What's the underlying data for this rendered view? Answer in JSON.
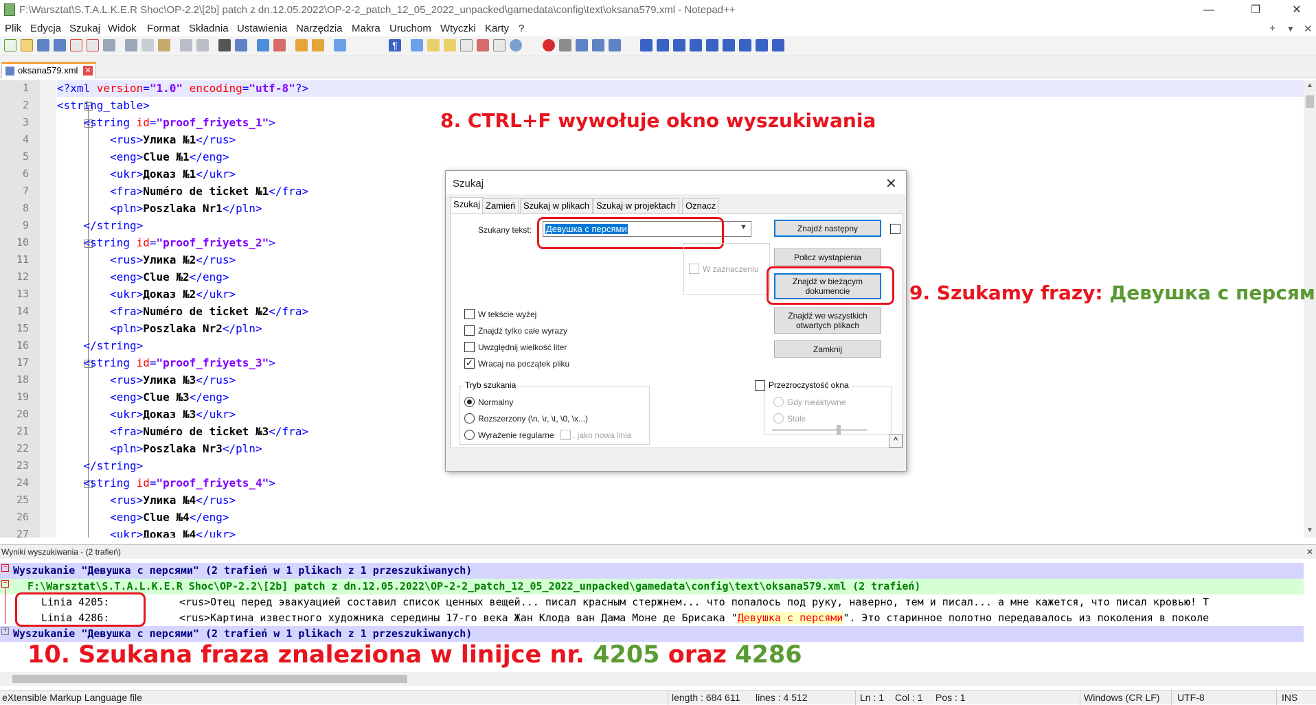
{
  "window": {
    "title": "F:\\Warsztat\\S.T.A.L.K.E.R Shoc\\OP-2.2\\[2b] patch z dn.12.05.2022\\OP-2-2_patch_12_05_2022_unpacked\\gamedata\\config\\text\\oksana579.xml - Notepad++",
    "controls": {
      "minimize": "—",
      "maximize": "❐",
      "close": "✕"
    },
    "menu_extra": {
      "add": "+",
      "list": "▼",
      "close": "✕"
    }
  },
  "menu": [
    "Plik",
    "Edycja",
    "Szukaj",
    "Widok",
    "Format",
    "Składnia",
    "Ustawienia",
    "Narzędzia",
    "Makra",
    "Uruchom",
    "Wtyczki",
    "Karty",
    "?"
  ],
  "tab": {
    "label": "oksana579.xml",
    "close": "✕"
  },
  "editor": {
    "line_numbers": [
      "1",
      "2",
      "3",
      "4",
      "5",
      "6",
      "7",
      "8",
      "9",
      "10",
      "11",
      "12",
      "13",
      "14",
      "15",
      "16",
      "17",
      "18",
      "19",
      "20",
      "21",
      "22",
      "23",
      "24",
      "25",
      "26",
      "27"
    ],
    "lines": [
      "<?xml version=\"1.0\" encoding=\"utf-8\"?>",
      "<string_table>",
      "    <string id=\"proof_friyets_1\">",
      "        <rus>Улика №1</rus>",
      "        <eng>Clue №1</eng>",
      "        <ukr>Доказ №1</ukr>",
      "        <fra>Numéro de ticket №1</fra>",
      "        <pln>Poszlaka Nr1</pln>",
      "    </string>",
      "    <string id=\"proof_friyets_2\">",
      "        <rus>Улика №2</rus>",
      "        <eng>Clue №2</eng>",
      "        <ukr>Доказ №2</ukr>",
      "        <fra>Numéro de ticket №2</fra>",
      "        <pln>Poszlaka Nr2</pln>",
      "    </string>",
      "    <string id=\"proof_friyets_3\">",
      "        <rus>Улика №3</rus>",
      "        <eng>Clue №3</eng>",
      "        <ukr>Доказ №3</ukr>",
      "        <fra>Numéro de ticket №3</fra>",
      "        <pln>Poszlaka Nr3</pln>",
      "    </string>",
      "    <string id=\"proof_friyets_4\">",
      "        <rus>Улика №4</rus>",
      "        <eng>Clue №4</eng>",
      "        <ukr>Доказ №4</ukr>"
    ]
  },
  "annotations": {
    "step8": "8. CTRL+F  wywołuje okno wyszukiwania",
    "step9_prefix": "9. Szukamy frazy: ",
    "step9_phrase": "Девушка с персями",
    "step10_prefix": "10. Szukana fraza znaleziona w linijce nr. ",
    "step10_n1": "4205",
    "step10_mid": " oraz ",
    "step10_n2": "4286",
    "colors": {
      "red": "#e8141e",
      "green": "#5a9a32"
    }
  },
  "dialog": {
    "title": "Szukaj",
    "close": "✕",
    "tabs": [
      "Szukaj",
      "Zamień",
      "Szukaj w plikach",
      "Szukaj w projektach",
      "Oznacz"
    ],
    "search_label": "Szukany tekst:",
    "search_value": "Девушка с персями",
    "in_selection": "W zaznaczeniu",
    "checkboxes": [
      {
        "label": "W tekście wyżej",
        "checked": false
      },
      {
        "label": "Znajdź tylko całe wyrazy",
        "checked": false
      },
      {
        "label": "Uwzględnij wielkość liter",
        "checked": false
      },
      {
        "label": "Wracaj na początek pliku",
        "checked": true
      }
    ],
    "mode_title": "Tryb szukania",
    "modes": [
      "Normalny",
      "Rozszerzony (\\n, \\r, \\t, \\0, \\x...)",
      "Wyrażenie regularne"
    ],
    "newline_opt": ". jako nowa linia",
    "buttons": {
      "find_next": "Znajdź następny",
      "count": "Policz wystąpienia",
      "find_current_1": "Znajdź w bieżącym",
      "find_current_2": "dokumencie",
      "find_all_1": "Znajdź we wszystkich",
      "find_all_2": "otwartych plikach",
      "close": "Zamknij"
    },
    "transparency": {
      "title": "Przezroczystość okna",
      "inactive": "Gdy nieaktywne",
      "always": "Stale"
    }
  },
  "results": {
    "panel_title": "Wyniki wyszukiwania - (2 trafień)",
    "close": "✕",
    "header1": "Wyszukanie \"Девушка с персями\" (2 trafień w 1 plikach z 1 przeszukiwanych)",
    "file_line": "F:\\Warsztat\\S.T.A.L.K.E.R Shoc\\OP-2.2\\[2b] patch z dn.12.05.2022\\OP-2-2_patch_12_05_2022_unpacked\\gamedata\\config\\text\\oksana579.xml (2 trafień)",
    "hit1_line": "Linia 4205:",
    "hit1_text": "<rus>Отец перед эвакуацией составил список ценных вещей... писал красным стержнем... что попалось под руку, наверно, тем и писал... а мне кажется, что писал кровью! Т",
    "hit2_line": "Linia 4286:",
    "hit2_text_pre": "<rus>Картина известного художника середины 17-го века Жан Клода ван Дама Моне де Брисака \"",
    "hit2_match": "Девушка с персями",
    "hit2_text_post": "\". Это старинное полотно передавалось из поколения в поколе",
    "header2": "Wyszukanie \"Девушка с персями\" (2 trafień w 1 plikach z 1 przeszukiwanych)"
  },
  "status": {
    "file_type": "eXtensible Markup Language file",
    "length": "length : 684 611",
    "lines": "lines : 4 512",
    "ln": "Ln : 1",
    "col": "Col : 1",
    "pos": "Pos : 1",
    "eol": "Windows (CR LF)",
    "encoding": "UTF-8",
    "mode": "INS"
  }
}
